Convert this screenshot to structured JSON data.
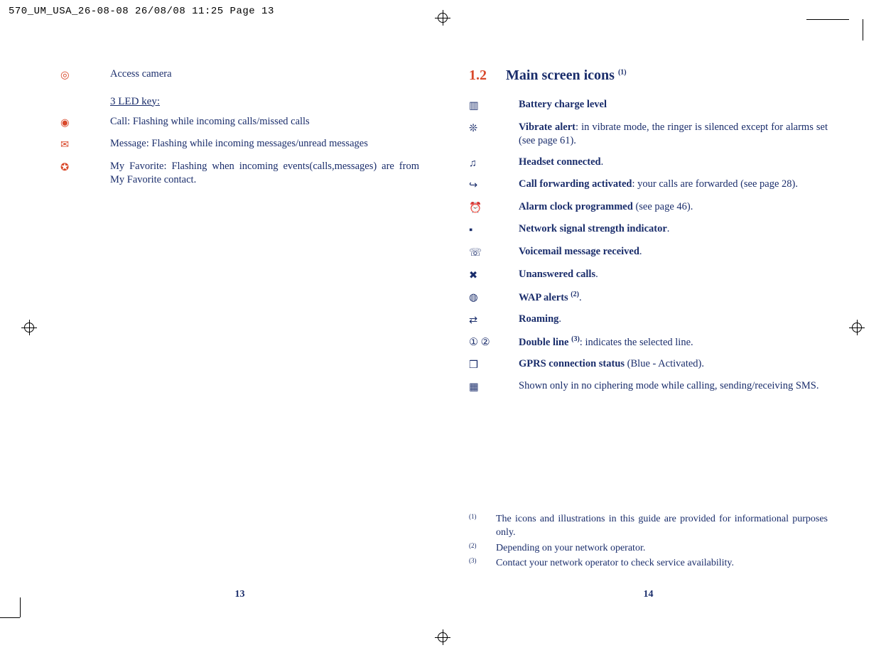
{
  "slug": "570_UM_USA_26-08-08  26/08/08  11:25  Page 13",
  "left": {
    "pageNumber": "13",
    "items": [
      {
        "icon": "camera-icon",
        "glyph": "◎",
        "text": "Access camera"
      }
    ],
    "subhead": "3 LED key:",
    "ledItems": [
      {
        "icon": "call-led-icon",
        "glyph": "◉",
        "text": "Call: Flashing while incoming calls/missed calls"
      },
      {
        "icon": "message-led-icon",
        "glyph": "✉",
        "text": "Message: Flashing while incoming messages/unread messages"
      },
      {
        "icon": "favorite-led-icon",
        "glyph": "✪",
        "text": "My Favorite: Flashing when incoming events(calls,messages) are from My Favorite contact."
      }
    ]
  },
  "right": {
    "pageNumber": "14",
    "sectionNum": "1.2",
    "sectionTitle": "Main screen icons ",
    "sectionSup": "(1)",
    "items": [
      {
        "icon": "battery-icon",
        "glyph": "▥",
        "bold": "Battery charge level",
        "rest": ""
      },
      {
        "icon": "vibrate-icon",
        "glyph": "❊",
        "bold": "Vibrate alert",
        "rest": ": in vibrate mode, the ringer is silenced except for alarms set (see page 61)."
      },
      {
        "icon": "headset-icon",
        "glyph": "♫",
        "bold": "Headset connected",
        "rest": "."
      },
      {
        "icon": "call-forward-icon",
        "glyph": "↪",
        "bold": "Call forwarding activated",
        "rest": ": your calls are forwarded (see page 28)."
      },
      {
        "icon": "alarm-icon",
        "glyph": "⏰",
        "bold": "Alarm clock programmed",
        "rest": " (see page 46)."
      },
      {
        "icon": "signal-icon",
        "glyph": "▪",
        "bold": "Network signal strength indicator",
        "rest": "."
      },
      {
        "icon": "voicemail-icon",
        "glyph": "☏",
        "bold": "Voicemail message received",
        "rest": "."
      },
      {
        "icon": "unanswered-icon",
        "glyph": "✖",
        "bold": "Unanswered calls",
        "rest": "."
      },
      {
        "icon": "wap-icon",
        "glyph": "◍",
        "bold": "WAP alerts ",
        "sup": "(2)",
        "rest": "."
      },
      {
        "icon": "roaming-icon",
        "glyph": "⇄",
        "bold": "Roaming",
        "rest": "."
      },
      {
        "icon": "double-line-icon",
        "glyph": "① ②",
        "bold": "Double line ",
        "sup": "(3)",
        "rest": ": indicates the selected line."
      },
      {
        "icon": "gprs-icon",
        "glyph": "❒",
        "bold": "GPRS connection status",
        "rest": " (Blue - Activated)."
      },
      {
        "icon": "ciphering-icon",
        "glyph": "▦",
        "bold": "",
        "rest": "Shown only in no ciphering mode while calling, sending/receiving SMS."
      }
    ],
    "footnotes": [
      {
        "mark": "(1)",
        "text": "The icons and illustrations in this guide are provided for informational purposes only."
      },
      {
        "mark": "(2)",
        "text": "Depending on your network operator."
      },
      {
        "mark": "(3)",
        "text": "Contact your network operator to check service availability."
      }
    ]
  }
}
